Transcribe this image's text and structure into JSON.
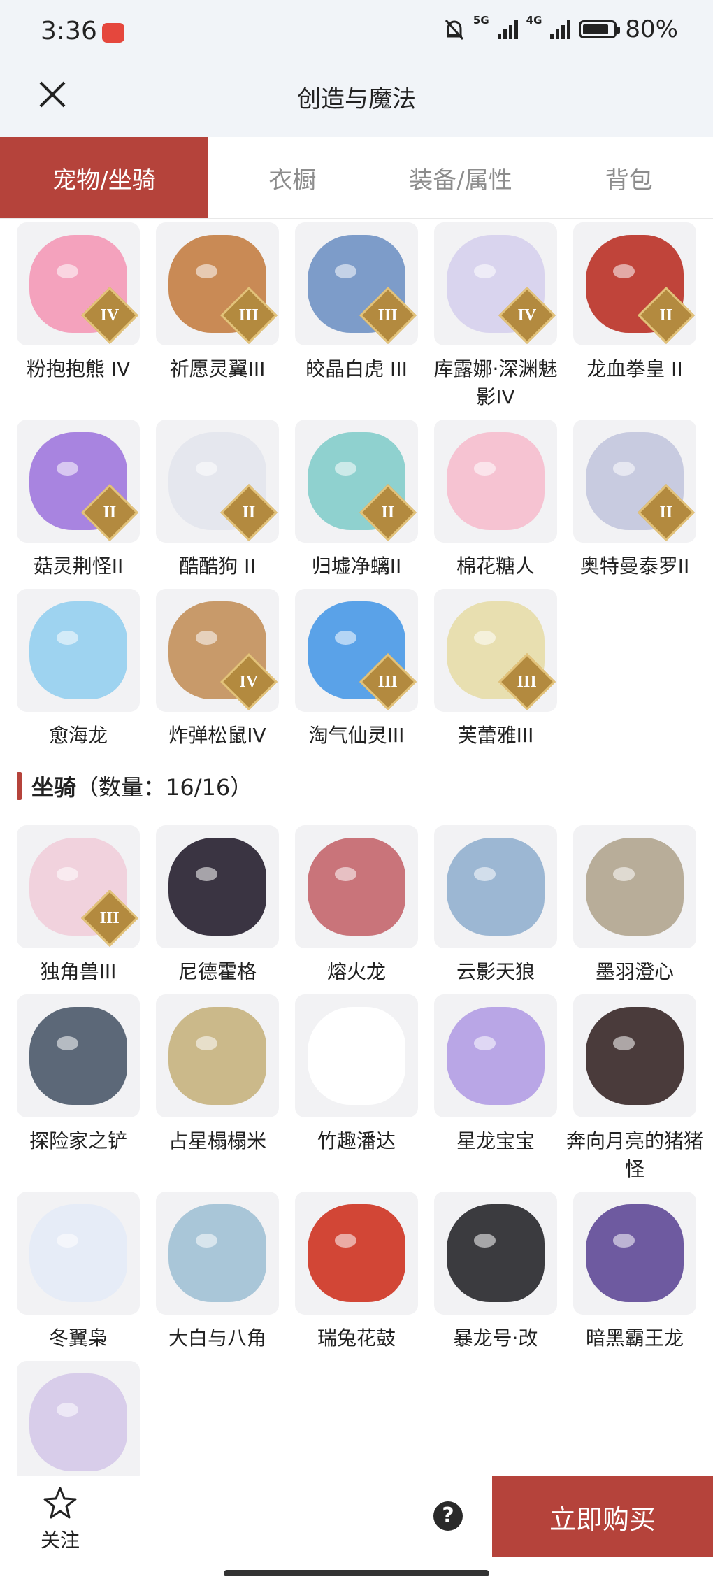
{
  "status_bar": {
    "time": "3:36",
    "net5g": "5G",
    "net4g": "4G",
    "battery": "80%"
  },
  "header": {
    "title": "创造与魔法"
  },
  "tabs": [
    {
      "label": "宠物/坐骑",
      "active": true
    },
    {
      "label": "衣橱",
      "active": false
    },
    {
      "label": "装备/属性",
      "active": false
    },
    {
      "label": "背包",
      "active": false
    }
  ],
  "pets": [
    {
      "name": "粉抱抱熊 IV",
      "tier": "IV",
      "color": "#f4a2bd"
    },
    {
      "name": "祈愿灵翼III",
      "tier": "III",
      "color": "#c98a55"
    },
    {
      "name": "皎晶白虎 III",
      "tier": "III",
      "color": "#7d9cc9"
    },
    {
      "name": "库露娜·深渊魅影IV",
      "tier": "IV",
      "color": "#d9d4ee"
    },
    {
      "name": "龙血拳皇 II",
      "tier": "II",
      "color": "#c0443a"
    },
    {
      "name": "菇灵荆怪II",
      "tier": "II",
      "color": "#a884e0"
    },
    {
      "name": "酷酷狗 II",
      "tier": "II",
      "color": "#e5e7ee"
    },
    {
      "name": "归墟净螭II",
      "tier": "II",
      "color": "#8fd1cf"
    },
    {
      "name": "棉花糖人",
      "tier": "",
      "color": "#f6c3d2"
    },
    {
      "name": "奥特曼泰罗II",
      "tier": "II",
      "color": "#c8cbe0"
    },
    {
      "name": "愈海龙",
      "tier": "",
      "color": "#9ed3f0"
    },
    {
      "name": "炸弹松鼠IV",
      "tier": "IV",
      "color": "#c89a6a"
    },
    {
      "name": "淘气仙灵III",
      "tier": "III",
      "color": "#5aa2e8"
    },
    {
      "name": "芙蕾雅III",
      "tier": "III",
      "color": "#e8dfb0"
    }
  ],
  "mount_section": {
    "title": "坐骑",
    "count_text": "（数量：16/16）"
  },
  "mounts": [
    {
      "name": "独角兽III",
      "tier": "III",
      "color": "#f1d2dd"
    },
    {
      "name": "尼德霍格",
      "tier": "",
      "color": "#3a3442"
    },
    {
      "name": "熔火龙",
      "tier": "",
      "color": "#c9747a"
    },
    {
      "name": "云影天狼",
      "tier": "",
      "color": "#9cb7d3"
    },
    {
      "name": "墨羽澄心",
      "tier": "",
      "color": "#b8ad99"
    },
    {
      "name": "探险家之铲",
      "tier": "",
      "color": "#5c6878"
    },
    {
      "name": "占星榻榻米",
      "tier": "",
      "color": "#cbb98a"
    },
    {
      "name": "竹趣潘达",
      "tier": "",
      "color": "#ffffff"
    },
    {
      "name": "星龙宝宝",
      "tier": "",
      "color": "#b9a6e6"
    },
    {
      "name": "奔向月亮的猪猪怪",
      "tier": "",
      "color": "#4a3b3b"
    },
    {
      "name": "冬翼枭",
      "tier": "",
      "color": "#e6ecf7"
    },
    {
      "name": "大白与八角",
      "tier": "",
      "color": "#a9c6d8"
    },
    {
      "name": "瑞兔花鼓",
      "tier": "",
      "color": "#d24636"
    },
    {
      "name": "暴龙号·改",
      "tier": "",
      "color": "#3b3b3f"
    },
    {
      "name": "暗黑霸王龙",
      "tier": "",
      "color": "#6e5aa0"
    },
    {
      "name": "",
      "tier": "",
      "color": "#d8cdea"
    }
  ],
  "bottom_bar": {
    "follow_label": "关注",
    "help_label": "?",
    "buy_label": "立即购买"
  },
  "colors": {
    "accent": "#b5433b",
    "header_bg": "#f1f4f8",
    "tile_bg": "#f2f2f4"
  },
  "icons": {
    "close": "close-icon",
    "follow": "star-icon",
    "help": "help-icon"
  }
}
